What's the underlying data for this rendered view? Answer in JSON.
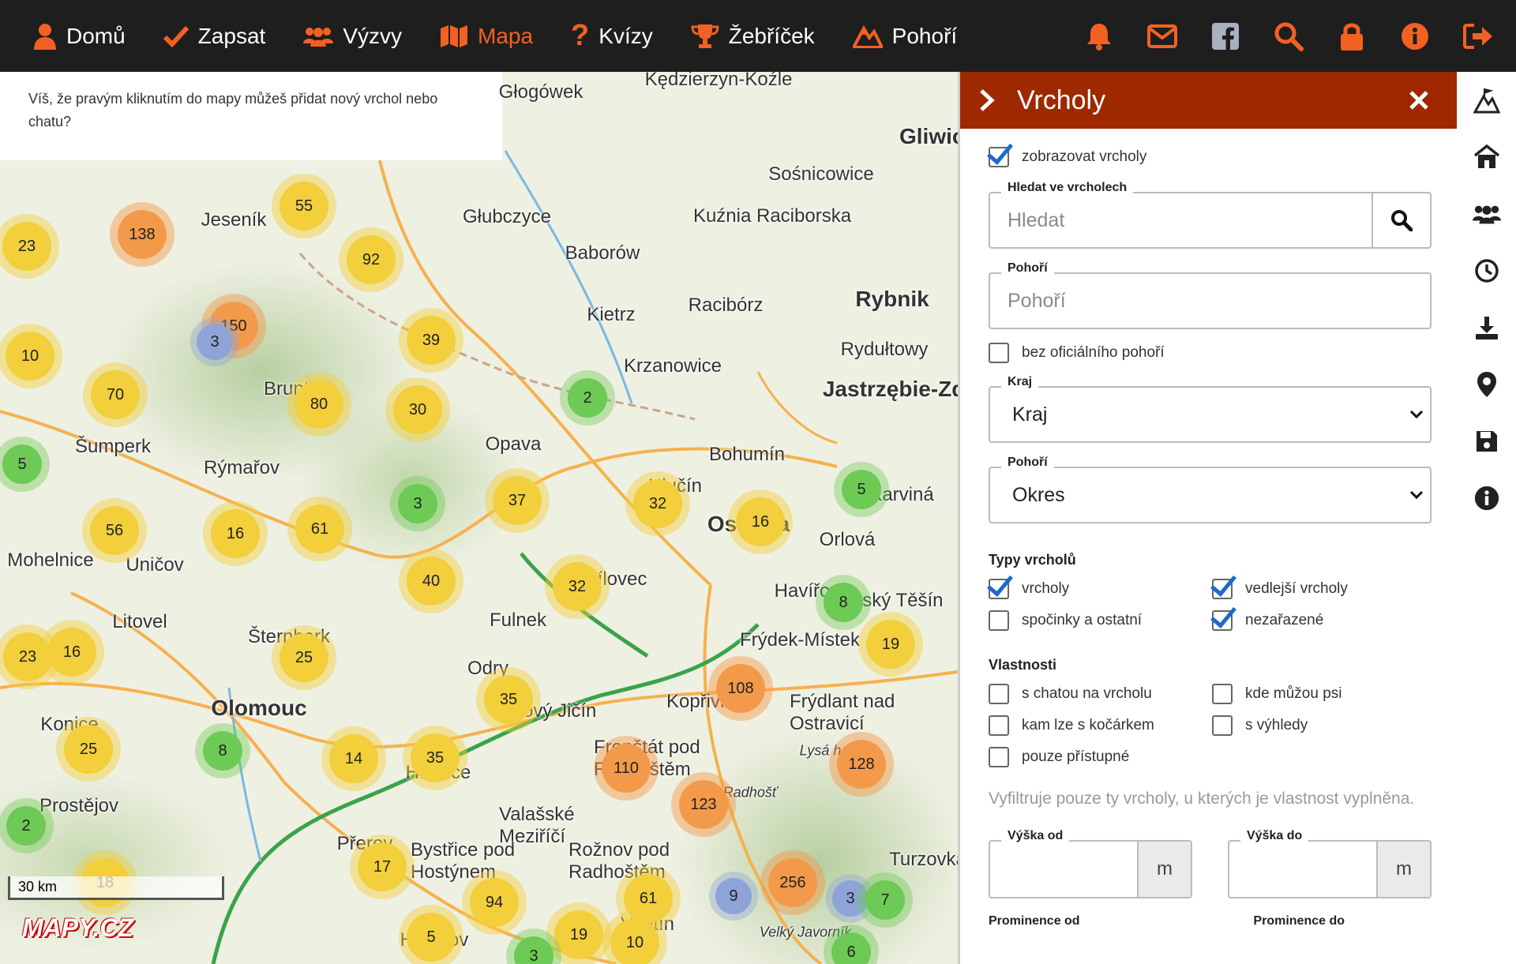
{
  "nav": {
    "items": [
      {
        "label": "Domů",
        "icon": "user-icon"
      },
      {
        "label": "Zapsat",
        "icon": "check-icon"
      },
      {
        "label": "Výzvy",
        "icon": "users-icon"
      },
      {
        "label": "Mapa",
        "icon": "map-icon",
        "active": true
      },
      {
        "label": "Kvízy",
        "icon": "question-icon"
      },
      {
        "label": "Žebříček",
        "icon": "trophy-icon"
      },
      {
        "label": "Pohoří",
        "icon": "mountains-icon"
      }
    ],
    "right_icons": [
      "bell-icon",
      "envelope-icon",
      "facebook-icon",
      "search-icon",
      "lock-icon",
      "info-icon",
      "logout-icon"
    ],
    "accent": "#f26122",
    "bg": "#1e1e1e"
  },
  "map": {
    "tip": "Víš, že pravým kliknutím do mapy můžeš přidat nový vrchol nebo chatu?",
    "scale": "30 km",
    "logo": "MAPY.CZ",
    "places": [
      "Głogówek",
      "Kędzierzyn-Koźle",
      "Gliwice",
      "Sośnicowice",
      "Kuźnia Raciborska",
      "Głubczyce",
      "Baborów",
      "Racibórz",
      "Rybnik",
      "Kietrz",
      "Rydułtowy",
      "Krzanowice",
      "Jastrzębie-Zdrój",
      "Jeseník",
      "Bruntál",
      "Opava",
      "Bohumín",
      "Šumperk",
      "Rýmařov",
      "Hlučín",
      "Ostrava",
      "Orlová",
      "Karviná",
      "Mohelnice",
      "Uničov",
      "Bílovec",
      "Havířov",
      "Český Těšín",
      "Litovel",
      "Fulnek",
      "Šternberk",
      "Frýdek-Místek",
      "Odry",
      "Nový Jičín",
      "Kopřivnice",
      "Frýdlant nad Ostravicí",
      "Olomouc",
      "Konice",
      "Hranice",
      "Frenštát pod Radhoštěm",
      "Prostějov",
      "Valašské Meziříčí",
      "Přerov",
      "Bystřice pod Hostýnem",
      "Rožnov pod Radhoštěm",
      "Vsetín",
      "Holešov",
      "Turzovka",
      "Velký Javorník",
      "Radhošť",
      "Lysá hora"
    ],
    "clusters": [
      138,
      55,
      92,
      23,
      150,
      3,
      10,
      39,
      70,
      80,
      30,
      2,
      5,
      56,
      16,
      61,
      3,
      37,
      32,
      16,
      5,
      40,
      32,
      8,
      19,
      23,
      16,
      25,
      35,
      108,
      8,
      14,
      35,
      110,
      123,
      128,
      25,
      2,
      17,
      94,
      61,
      256,
      3,
      7,
      5,
      19,
      10,
      9,
      18,
      6,
      3
    ]
  },
  "panel": {
    "title": "Vrcholy",
    "show_peaks": "zobrazovat vrcholy",
    "search_legend": "Hledat ve vrcholech",
    "search_placeholder": "Hledat",
    "range_legend": "Pohoří",
    "range_placeholder": "Pohoří",
    "no_range": "bez oficiálního pohoří",
    "region_legend": "Kraj",
    "region_value": "Kraj",
    "district_legend": "Pohoří",
    "district_value": "Okres",
    "types_title": "Typy vrcholů",
    "types": [
      {
        "label": "vrcholy",
        "checked": true
      },
      {
        "label": "vedlejší vrcholy",
        "checked": true
      },
      {
        "label": "spočinky a ostatní",
        "checked": false
      },
      {
        "label": "nezařazené",
        "checked": true
      }
    ],
    "props_title": "Vlastnosti",
    "props": [
      {
        "label": "s chatou na vrcholu",
        "checked": false
      },
      {
        "label": "kde můžou psi",
        "checked": false
      },
      {
        "label": "kam lze s kočárkem",
        "checked": false
      },
      {
        "label": "s výhledy",
        "checked": false
      },
      {
        "label": "pouze přístupné",
        "checked": false
      }
    ],
    "props_note": "Vyfiltruje pouze ty vrcholy, u kterých je vlastnost vyplněna.",
    "height_from": "Výška od",
    "height_to": "Výška do",
    "unit": "m",
    "prom_from": "Prominence od",
    "prom_to": "Prominence do",
    "header_color": "#9e2900"
  },
  "rail": {
    "icons": [
      "peaks-icon",
      "hut-icon",
      "group-icon",
      "clock-icon",
      "download-icon",
      "pin-icon",
      "save-icon",
      "info-icon"
    ]
  }
}
